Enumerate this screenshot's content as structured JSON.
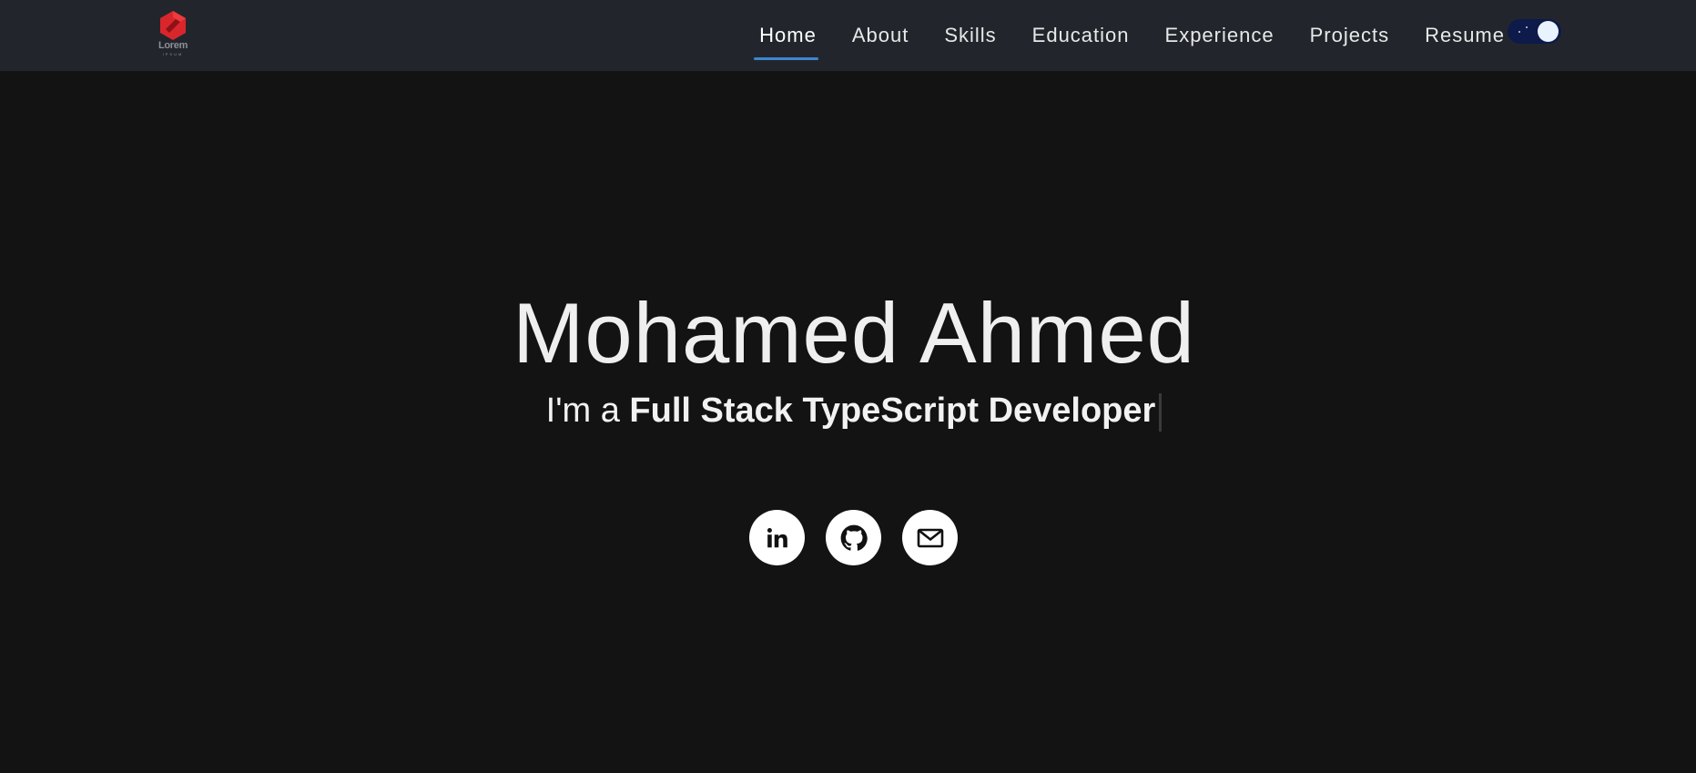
{
  "logo": {
    "text": "Lorem",
    "subtext": "IPSUM",
    "icon": "hexagon-logo-icon",
    "color": "#d9262c"
  },
  "nav": {
    "items": [
      {
        "label": "Home",
        "active": true
      },
      {
        "label": "About"
      },
      {
        "label": "Skills"
      },
      {
        "label": "Education"
      },
      {
        "label": "Experience"
      },
      {
        "label": "Projects"
      },
      {
        "label": "Resume"
      }
    ],
    "active_color": "#3d86d1",
    "theme_toggle": {
      "state": "dark",
      "icon": "moon-toggle-icon"
    }
  },
  "hero": {
    "name": "Mohamed Ahmed",
    "prefix": "I'm a ",
    "role": "Full Stack TypeScript Developer"
  },
  "socials": [
    {
      "name": "linkedin",
      "icon": "linkedin-icon"
    },
    {
      "name": "github",
      "icon": "github-icon"
    },
    {
      "name": "email",
      "icon": "mail-icon"
    }
  ],
  "colors": {
    "background": "#131313",
    "navbar": "#22262c"
  }
}
